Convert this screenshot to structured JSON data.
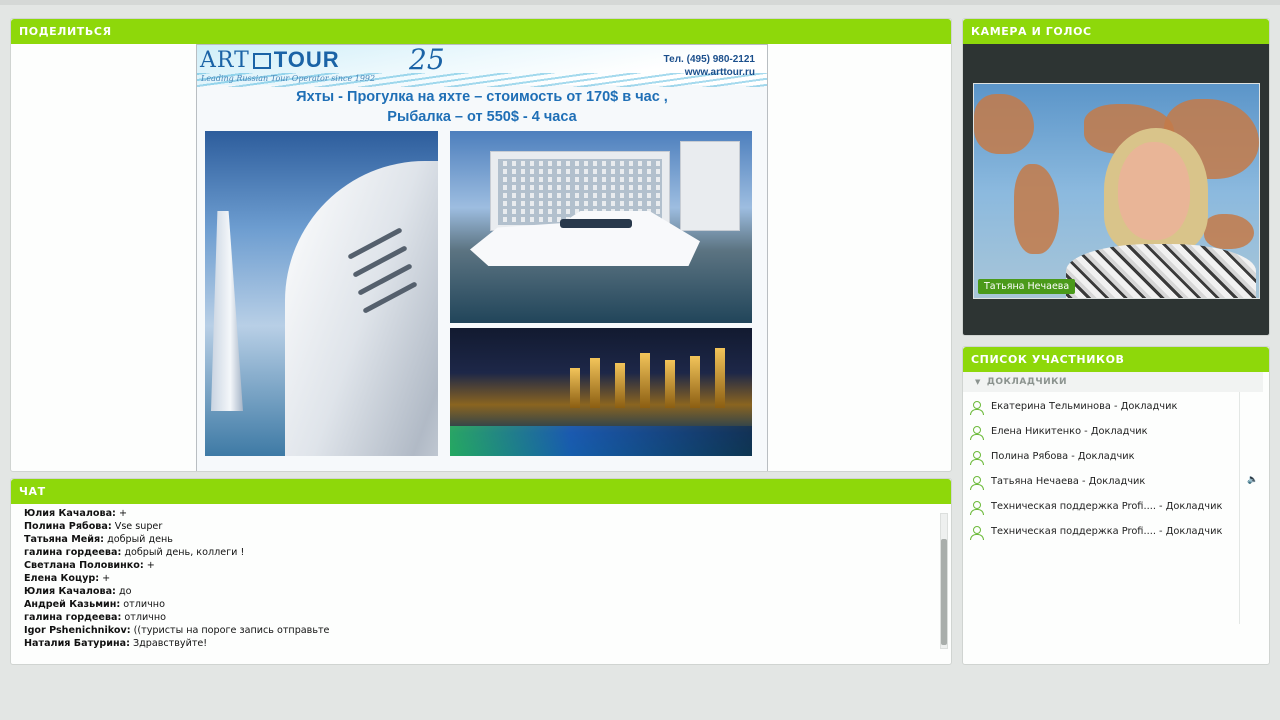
{
  "share": {
    "title": "ПОДЕЛИТЬСЯ",
    "slide": {
      "logo_art": "ART",
      "logo_tour": "TOUR",
      "anniversary": "25",
      "tagline": "Leading Russian Tour Operator since 1992",
      "phone": "Тел. (495) 980-2121",
      "website": "www.arttour.ru",
      "title_line1": "Яхты - Прогулка на яхте – стоимость от 170$ в час ,",
      "title_line2": "Рыбалка – от 550$ - 4 часа"
    }
  },
  "chat": {
    "title": "ЧАТ",
    "messages": [
      {
        "author": "Юлия Качалова:",
        "text": "+"
      },
      {
        "author": "Полина Рябова:",
        "text": "Vse super"
      },
      {
        "author": "Татьяна Мейя:",
        "text": "добрый день"
      },
      {
        "author": "галина гордеева:",
        "text": "добрый день, коллеги !"
      },
      {
        "author": "Светлана Половинко:",
        "text": "+"
      },
      {
        "author": "Елена Коцур:",
        "text": "+"
      },
      {
        "author": "Юлия Качалова:",
        "text": "до"
      },
      {
        "author": "Андрей Казьмин:",
        "text": "отлично"
      },
      {
        "author": "галина гордеева:",
        "text": "отлично"
      },
      {
        "author": "Igor Pshenichnikov:",
        "text": "((туристы на пороге запись отправьте"
      },
      {
        "author": "Наталия Батурина:",
        "text": "Здравствуйте!"
      }
    ]
  },
  "camera": {
    "title": "КАМЕРА И ГОЛОС",
    "presenter_name": "Татьяна Нечаева"
  },
  "attendees": {
    "title": "СПИСОК УЧАСТНИКОВ",
    "group_label": "ДОКЛАДЧИКИ",
    "people": [
      {
        "name": "Екатерина Тельминова  - Докладчик"
      },
      {
        "name": "Елена Никитенко  - Докладчик"
      },
      {
        "name": "Полина Рябова  - Докладчик"
      },
      {
        "name": "Татьяна Нечаева  - Докладчик"
      },
      {
        "name": "Техническая поддержка Profi....  - Докладчик"
      },
      {
        "name": "Техническая поддержка Profi....  - Докладчик"
      }
    ]
  },
  "colors": {
    "pod_header": "#8ed80a",
    "user_icon": "#6cba3a",
    "name_tag": "#4a9a1a",
    "speaking_indicator": "#3da843"
  },
  "icons": {
    "attendee": "user-icon",
    "speaking": "speaker-icon",
    "group_toggle": "triangle-down-icon"
  }
}
